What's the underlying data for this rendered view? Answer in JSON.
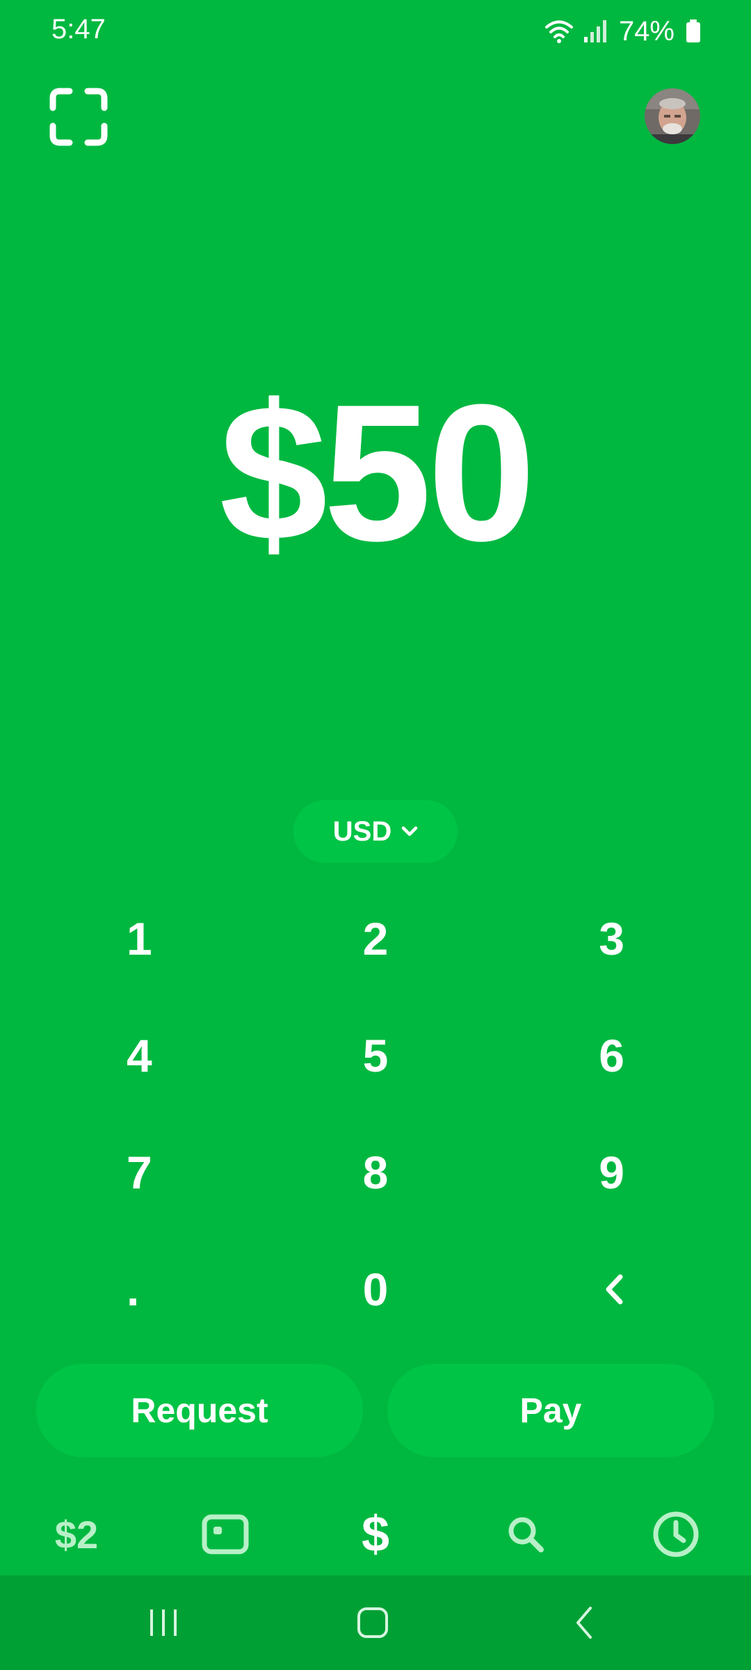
{
  "status_bar": {
    "time": "5:47",
    "battery": "74%",
    "icons": [
      "wifi-icon",
      "signal-icon",
      "battery-icon"
    ]
  },
  "header": {
    "scan_icon": "scan-qr-icon",
    "avatar": "profile-avatar"
  },
  "amount": {
    "display": "$50"
  },
  "currency": {
    "selected": "USD",
    "icon": "chevron-down-icon"
  },
  "keypad": {
    "keys": [
      "1",
      "2",
      "3",
      "4",
      "5",
      "6",
      "7",
      "8",
      "9",
      ".",
      "0"
    ],
    "backspace_icon": "chevron-left-icon"
  },
  "actions": {
    "request_label": "Request",
    "pay_label": "Pay"
  },
  "tabs": {
    "balance_label": "$2",
    "pay_label": "$",
    "icons": [
      "card-icon",
      "search-icon",
      "clock-icon"
    ]
  },
  "nav": {
    "icons": [
      "recents-icon",
      "home-icon",
      "back-icon"
    ]
  },
  "colors": {
    "background": "#00b840",
    "pill": "#00c445",
    "nav_bar": "#00a035",
    "inactive_tab": "#b8f0c8"
  }
}
